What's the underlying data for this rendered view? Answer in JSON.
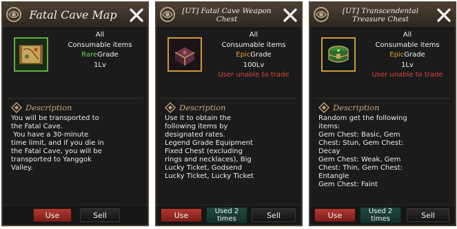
{
  "panels": [
    {
      "title": "Fatal Cave Map",
      "icon": "treasure-map-scroll",
      "frame_color": "#5bb13c",
      "target": "All",
      "item_type": "Consumable items",
      "grade_word": "Rare",
      "grade_suffix": "Grade",
      "level": "1Lv",
      "description_label": "Description",
      "description": "You will be transported to\nthe Fatal Cave.\n You have a 30-minute\ntime limit, and if you die in\nthe Fatal Cave, you will be\ntransported to Yanggok\nValley.",
      "use_label": "Use",
      "sell_label": "Sell"
    },
    {
      "title": "[UT] Fatal Cave Weapon Chest",
      "icon": "weapon-chest",
      "frame_color": "#d19a36",
      "target": "All",
      "item_type": "Consumable items",
      "grade_word": "Epic",
      "grade_suffix": "Grade",
      "level": "100Lv",
      "trade_note": "User unable to trade",
      "description_label": "Description",
      "description": "Use it to obtain the\nfollowing items by\ndesignated rates.\nLegend Grade Equipment\nFixed Chest (excluding\nrings and necklaces), Big\nLucky Ticket, Godsend\nLucky Ticket, Lucky Ticket",
      "use_label": "Use",
      "used_label": "Used 2 times",
      "sell_label": "Sell"
    },
    {
      "title": "[UT] Transcendental Treasure Chest",
      "icon": "treasure-chest",
      "frame_color": "#d19a36",
      "target": "All",
      "item_type": "Consumable items",
      "grade_word": "Epic",
      "grade_suffix": "Grade",
      "level": "1Lv",
      "trade_note": "User unable to trade",
      "description_label": "Description",
      "description": "Random get the following\nitems:\nGem Chest: Basic, Gem\nChest: Stun, Gem Chest:\nDecay\nGem Chest: Weak, Gem\nChest: Thin, Gem Chest:\nEntangle\nGem Chest: Faint",
      "use_label": "Use",
      "used_label": "Used 2 times",
      "sell_label": "Sell"
    }
  ]
}
